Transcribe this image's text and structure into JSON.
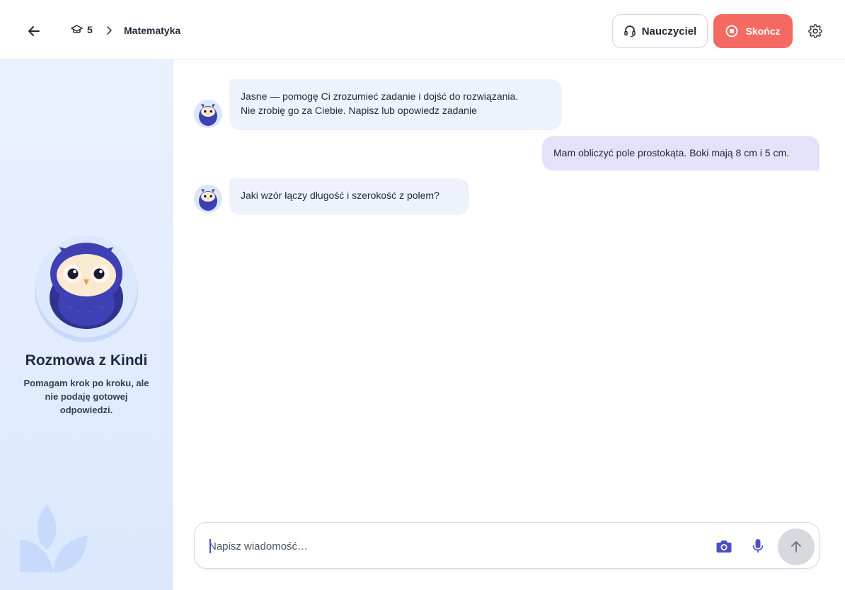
{
  "header": {
    "back_icon": "arrow-left-icon",
    "grade_icon": "graduation-cap-icon",
    "grade": "5",
    "subject": "Matematyka",
    "teacher_label": "Nauczyciel",
    "teacher_icon": "headset-icon",
    "end_label": "Skończ",
    "end_icon": "stop-circle-icon",
    "settings_icon": "gear-icon"
  },
  "sidebar": {
    "title": "Rozmowa z Kindi",
    "description": "Pomagam krok po kroku, ale nie podaję gotowej odpowiedzi."
  },
  "messages": [
    {
      "role": "bot",
      "lines": [
        "Jasne — pomogę Ci zrozumieć zadanie i dojść do rozwiązania.",
        "Nie zrobię go za Ciebie. Napisz lub opowiedz zadanie"
      ]
    },
    {
      "role": "user",
      "lines": [
        "Mam obliczyć pole prostokąta. Boki mają 8 cm i 5 cm."
      ]
    },
    {
      "role": "bot",
      "lines": [
        "Jaki wzór łączy długość i szerokość z polem?"
      ]
    }
  ],
  "composer": {
    "placeholder": "Napisz wiadomość…",
    "value": "",
    "camera_icon": "camera-icon",
    "mic_icon": "microphone-icon",
    "send_icon": "arrow-up-icon"
  },
  "colors": {
    "accent": "#4c4fc4",
    "end_button": "#f46a63",
    "bot_bubble": "#eef2fd",
    "user_bubble": "#e4e2fa",
    "sidebar_bg": "#e3edfd"
  }
}
